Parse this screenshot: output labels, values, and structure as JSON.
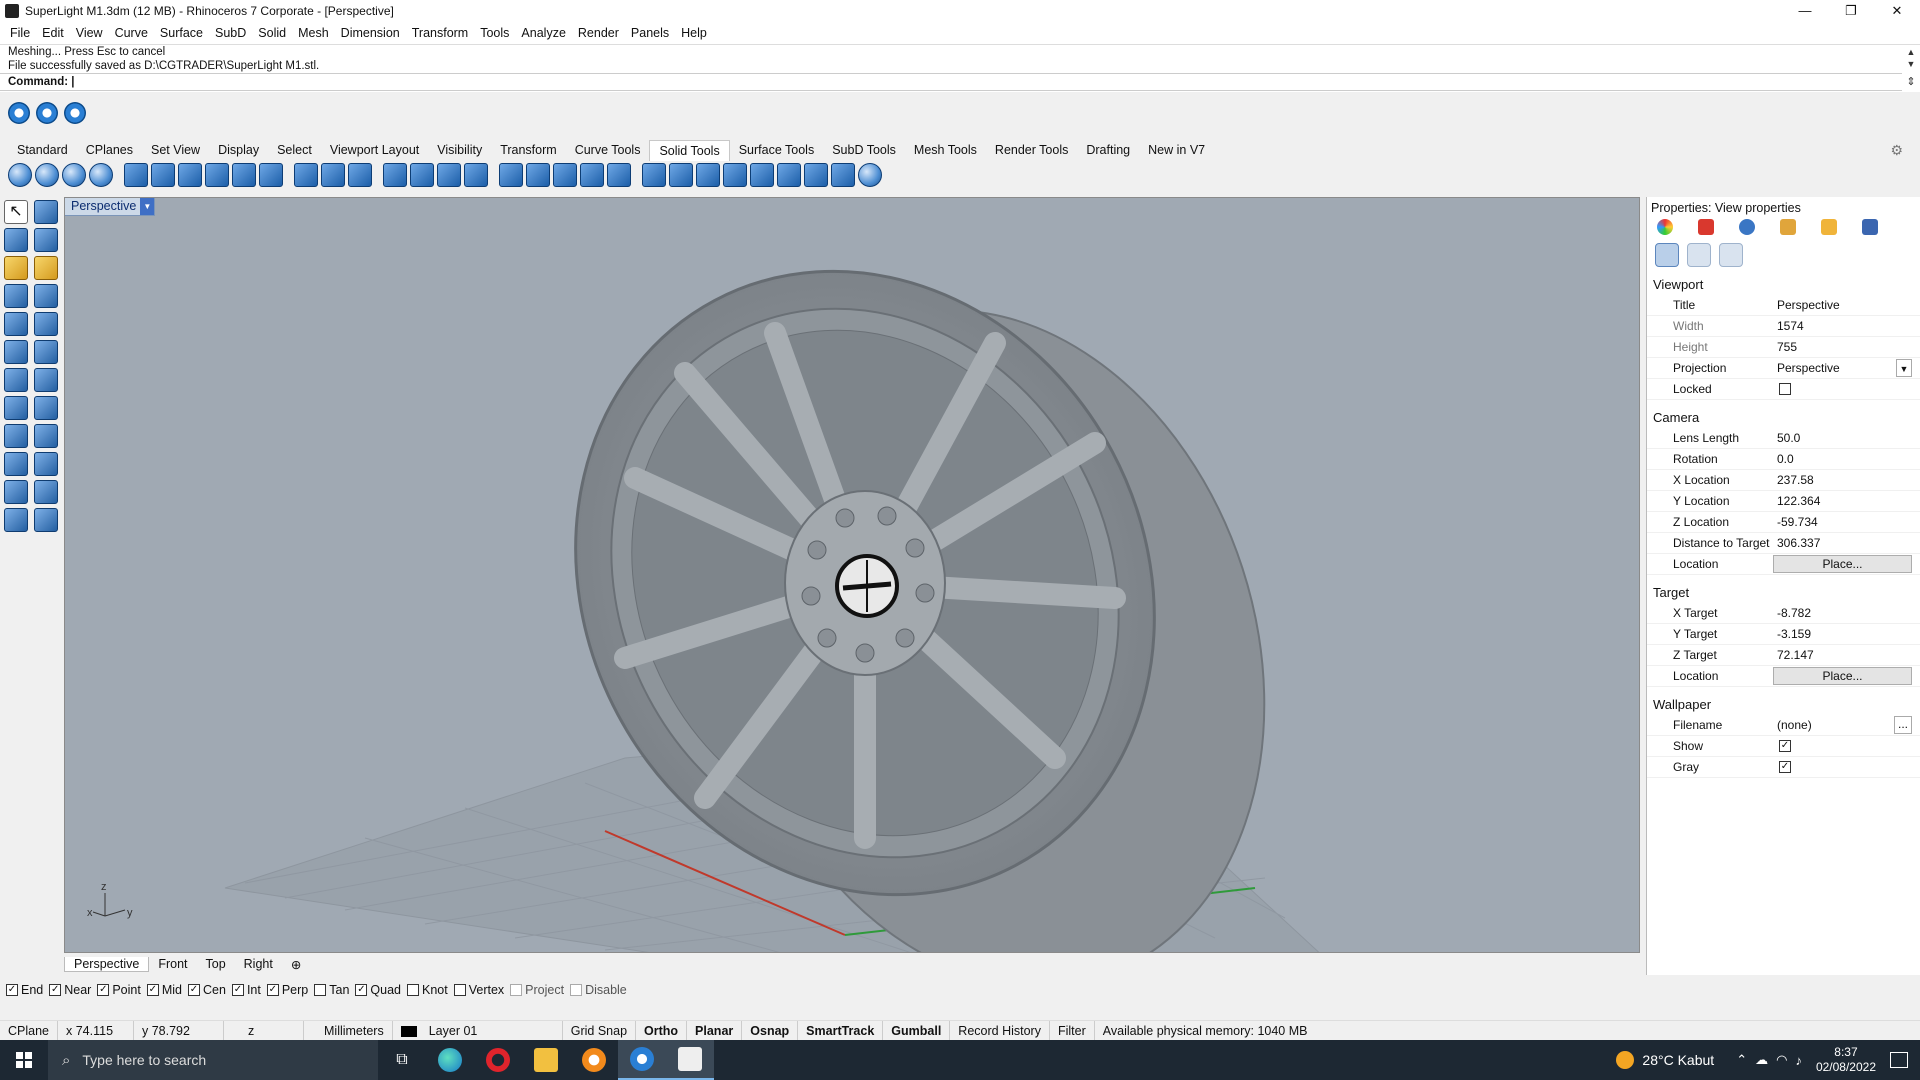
{
  "window": {
    "title": "SuperLight M1.3dm (12 MB) - Rhinoceros 7 Corporate - [Perspective]",
    "controls": [
      "—",
      "❐",
      "✕"
    ]
  },
  "menu": [
    "File",
    "Edit",
    "View",
    "Curve",
    "Surface",
    "SubD",
    "Solid",
    "Mesh",
    "Dimension",
    "Transform",
    "Tools",
    "Analyze",
    "Render",
    "Panels",
    "Help"
  ],
  "command": {
    "history": [
      "Meshing... Press Esc to cancel",
      "File successfully saved as D:\\CGTRADER\\SuperLight M1.stl."
    ],
    "prompt": "Command:"
  },
  "toolbar_tabs": [
    "Standard",
    "CPlanes",
    "Set View",
    "Display",
    "Select",
    "Viewport Layout",
    "Visibility",
    "Transform",
    "Curve Tools",
    "Solid Tools",
    "Surface Tools",
    "SubD Tools",
    "Mesh Tools",
    "Render Tools",
    "Drafting",
    "New in V7"
  ],
  "active_tab": "Solid Tools",
  "viewport": {
    "label": "Perspective",
    "axis": {
      "z": "z",
      "y": "y",
      "x": "x"
    }
  },
  "viewport_tabs": [
    "Perspective",
    "Front",
    "Top",
    "Right",
    "⊕"
  ],
  "osnaps": [
    {
      "label": "End",
      "checked": true
    },
    {
      "label": "Near",
      "checked": true
    },
    {
      "label": "Point",
      "checked": true
    },
    {
      "label": "Mid",
      "checked": true
    },
    {
      "label": "Cen",
      "checked": true
    },
    {
      "label": "Int",
      "checked": true
    },
    {
      "label": "Perp",
      "checked": true
    },
    {
      "label": "Tan",
      "checked": false
    },
    {
      "label": "Quad",
      "checked": true
    },
    {
      "label": "Knot",
      "checked": false
    },
    {
      "label": "Vertex",
      "checked": false
    },
    {
      "label": "Project",
      "checked": false,
      "disabled": true
    },
    {
      "label": "Disable",
      "checked": false,
      "disabled": true
    }
  ],
  "status": {
    "cplane": "CPlane",
    "x": "x 74.115",
    "y": "y 78.792",
    "z": "z",
    "units": "Millimeters",
    "layer": "Layer 01",
    "grid_snap": "Grid Snap",
    "ortho": "Ortho",
    "planar": "Planar",
    "osnap": "Osnap",
    "smarttrack": "SmartTrack",
    "gumball": "Gumball",
    "record_history": "Record History",
    "filter": "Filter",
    "memory": "Available physical memory: 1040 MB"
  },
  "properties": {
    "title": "Properties: View properties",
    "viewport_section": "Viewport",
    "title_label": "Title",
    "title_value": "Perspective",
    "width_label": "Width",
    "width_value": "1574",
    "height_label": "Height",
    "height_value": "755",
    "projection_label": "Projection",
    "projection_value": "Perspective",
    "locked_label": "Locked",
    "camera_section": "Camera",
    "lens_label": "Lens Length",
    "lens_value": "50.0",
    "rotation_label": "Rotation",
    "rotation_value": "0.0",
    "xloc_label": "X Location",
    "xloc_value": "237.58",
    "yloc_label": "Y Location",
    "yloc_value": "122.364",
    "zloc_label": "Z Location",
    "zloc_value": "-59.734",
    "dist_label": "Distance to Target",
    "dist_value": "306.337",
    "location_label": "Location",
    "place_label": "Place...",
    "target_section": "Target",
    "xt_label": "X Target",
    "xt_value": "-8.782",
    "yt_label": "Y Target",
    "yt_value": "-3.159",
    "zt_label": "Z Target",
    "zt_value": "72.147",
    "target_location_label": "Location",
    "target_place_label": "Place...",
    "wallpaper_section": "Wallpaper",
    "filename_label": "Filename",
    "filename_value": "(none)",
    "browse": "...",
    "show_label": "Show",
    "gray_label": "Gray"
  },
  "taskbar": {
    "search_placeholder": "Type here to search",
    "weather": "28°C  Kabut",
    "time": "8:37",
    "date": "02/08/2022"
  },
  "colors": {
    "viewport_bg": "#a0a9b3",
    "x_axis": "#c0392b",
    "y_axis": "#2f9a3a",
    "taskbar": "#1d2833"
  }
}
